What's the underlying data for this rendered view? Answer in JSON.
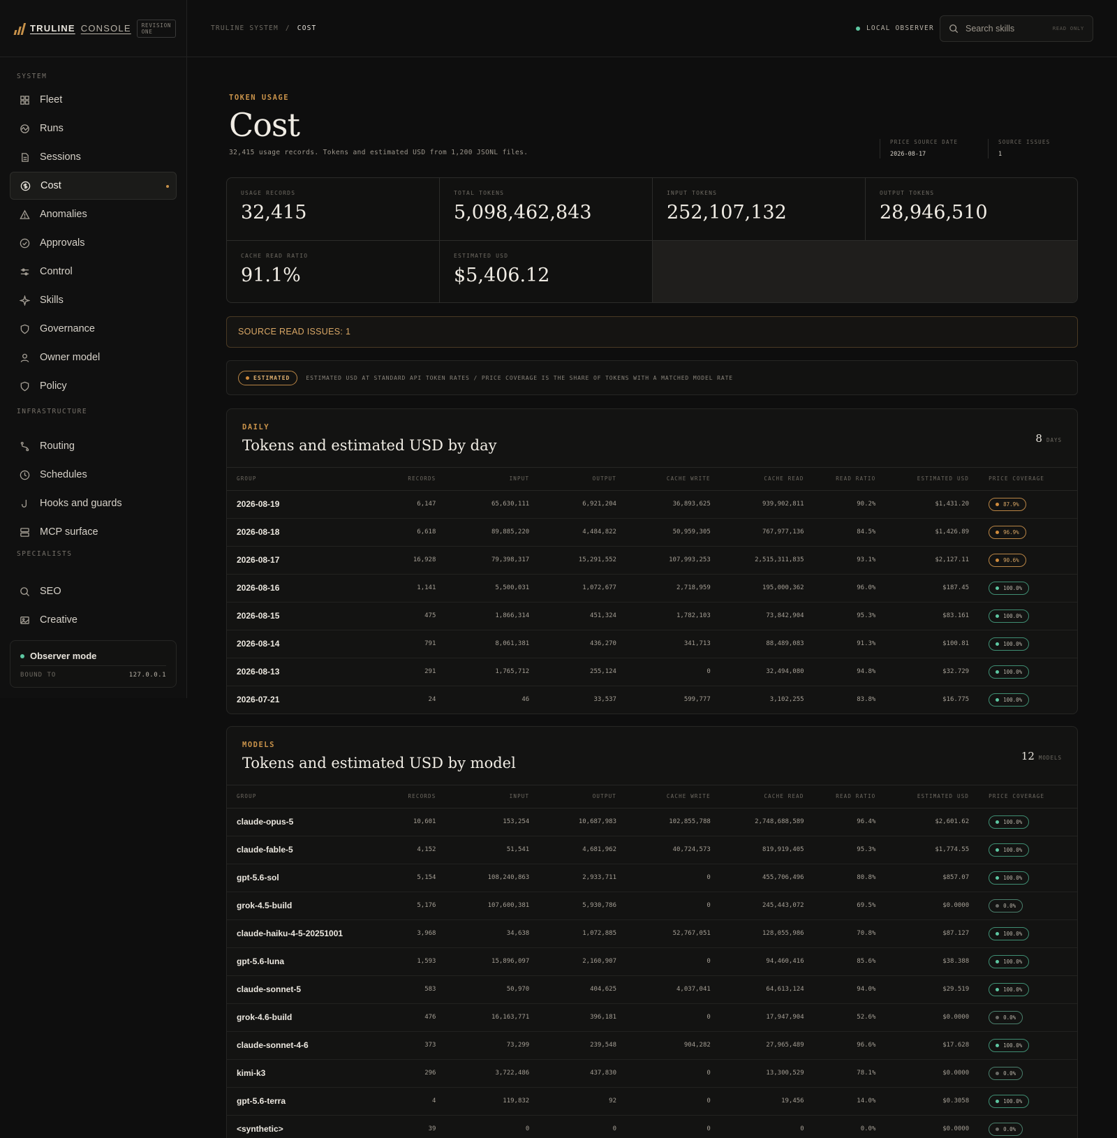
{
  "brand": {
    "name": "TRULINE",
    "console": "CONSOLE",
    "revision": "REVISION ONE"
  },
  "sidebar": {
    "sections": [
      {
        "label": "SYSTEM",
        "items": [
          "Fleet",
          "Runs",
          "Sessions",
          "Cost",
          "Anomalies",
          "Approvals",
          "Control",
          "Skills",
          "Governance",
          "Owner model",
          "Policy"
        ]
      },
      {
        "label": "INFRASTRUCTURE",
        "items": [
          "Routing",
          "Schedules",
          "Hooks and guards",
          "MCP surface"
        ]
      },
      {
        "label": "SPECIALISTS",
        "items": [
          "SEO",
          "Creative"
        ]
      }
    ],
    "active": "Cost",
    "observer": {
      "title": "Observer mode",
      "bound_label": "BOUND TO",
      "bound_value": "127.0.0.1"
    }
  },
  "topbar": {
    "breadcrumb": [
      "TRULINE SYSTEM",
      "/",
      "COST"
    ],
    "status": "LOCAL OBSERVER",
    "search": {
      "placeholder": "Search skills",
      "badge": "READ ONLY"
    }
  },
  "header": {
    "eyebrow": "TOKEN USAGE",
    "title": "Cost",
    "subtitle": "32,415 usage records. Tokens and estimated USD from 1,200 JSONL files.",
    "meta": [
      {
        "label": "PRICE SOURCE DATE",
        "value": "2026-08-17"
      },
      {
        "label": "SOURCE ISSUES",
        "value": "1"
      }
    ]
  },
  "stats": [
    {
      "label": "USAGE RECORDS",
      "value": "32,415"
    },
    {
      "label": "TOTAL TOKENS",
      "value": "5,098,462,843"
    },
    {
      "label": "INPUT TOKENS",
      "value": "252,107,132"
    },
    {
      "label": "OUTPUT TOKENS",
      "value": "28,946,510"
    },
    {
      "label": "CACHE READ RATIO",
      "value": "91.1%"
    },
    {
      "label": "ESTIMATED USD",
      "value": "$5,406.12"
    }
  ],
  "issue_banner": "SOURCE READ ISSUES: 1",
  "estimated_note": {
    "badge": "ESTIMATED",
    "text": "ESTIMATED USD AT STANDARD API TOKEN RATES / PRICE COVERAGE IS THE SHARE OF TOKENS WITH A MATCHED MODEL RATE"
  },
  "columns": [
    "GROUP",
    "RECORDS",
    "INPUT",
    "OUTPUT",
    "CACHE WRITE",
    "CACHE READ",
    "READ RATIO",
    "ESTIMATED USD",
    "PRICE COVERAGE"
  ],
  "daily": {
    "eyebrow": "DAILY",
    "title": "Tokens and estimated USD by day",
    "count": "8",
    "count_unit": "DAYS",
    "rows": [
      [
        "2026-08-19",
        "6,147",
        "65,630,111",
        "6,921,204",
        "36,893,625",
        "939,902,811",
        "90.2%",
        "$1,431.20",
        "87.9%"
      ],
      [
        "2026-08-18",
        "6,618",
        "89,885,220",
        "4,484,822",
        "50,959,305",
        "767,977,136",
        "84.5%",
        "$1,426.89",
        "96.9%"
      ],
      [
        "2026-08-17",
        "16,928",
        "79,398,317",
        "15,291,552",
        "107,993,253",
        "2,515,311,835",
        "93.1%",
        "$2,127.11",
        "90.6%"
      ],
      [
        "2026-08-16",
        "1,141",
        "5,500,031",
        "1,072,677",
        "2,718,959",
        "195,000,362",
        "96.0%",
        "$187.45",
        "100.0%"
      ],
      [
        "2026-08-15",
        "475",
        "1,866,314",
        "451,324",
        "1,782,103",
        "73,842,904",
        "95.3%",
        "$83.161",
        "100.0%"
      ],
      [
        "2026-08-14",
        "791",
        "8,061,381",
        "436,270",
        "341,713",
        "88,489,083",
        "91.3%",
        "$100.81",
        "100.0%"
      ],
      [
        "2026-08-13",
        "291",
        "1,765,712",
        "255,124",
        "0",
        "32,494,080",
        "94.8%",
        "$32.729",
        "100.0%"
      ],
      [
        "2026-07-21",
        "24",
        "46",
        "33,537",
        "599,777",
        "3,102,255",
        "83.8%",
        "$16.775",
        "100.0%"
      ]
    ]
  },
  "models": {
    "eyebrow": "MODELS",
    "title": "Tokens and estimated USD by model",
    "count": "12",
    "count_unit": "MODELS",
    "rows": [
      [
        "claude-opus-5",
        "10,601",
        "153,254",
        "10,687,983",
        "102,855,788",
        "2,748,688,589",
        "96.4%",
        "$2,601.62",
        "100.0%"
      ],
      [
        "claude-fable-5",
        "4,152",
        "51,541",
        "4,681,962",
        "40,724,573",
        "819,919,405",
        "95.3%",
        "$1,774.55",
        "100.0%"
      ],
      [
        "gpt-5.6-sol",
        "5,154",
        "108,240,863",
        "2,933,711",
        "0",
        "455,706,496",
        "80.8%",
        "$857.07",
        "100.0%"
      ],
      [
        "grok-4.5-build",
        "5,176",
        "107,600,381",
        "5,930,786",
        "0",
        "245,443,072",
        "69.5%",
        "$0.0000",
        "0.0%"
      ],
      [
        "claude-haiku-4-5-20251001",
        "3,968",
        "34,638",
        "1,072,885",
        "52,767,051",
        "128,055,986",
        "70.8%",
        "$87.127",
        "100.0%"
      ],
      [
        "gpt-5.6-luna",
        "1,593",
        "15,896,097",
        "2,160,907",
        "0",
        "94,460,416",
        "85.6%",
        "$38.388",
        "100.0%"
      ],
      [
        "claude-sonnet-5",
        "583",
        "50,970",
        "404,625",
        "4,037,041",
        "64,613,124",
        "94.0%",
        "$29.519",
        "100.0%"
      ],
      [
        "grok-4.6-build",
        "476",
        "16,163,771",
        "396,181",
        "0",
        "17,947,904",
        "52.6%",
        "$0.0000",
        "0.0%"
      ],
      [
        "claude-sonnet-4-6",
        "373",
        "73,299",
        "239,548",
        "904,282",
        "27,965,489",
        "96.6%",
        "$17.628",
        "100.0%"
      ],
      [
        "kimi-k3",
        "296",
        "3,722,486",
        "437,830",
        "0",
        "13,300,529",
        "78.1%",
        "$0.0000",
        "0.0%"
      ],
      [
        "gpt-5.6-terra",
        "4",
        "119,832",
        "92",
        "0",
        "19,456",
        "14.0%",
        "$0.3058",
        "100.0%"
      ],
      [
        "<synthetic>",
        "39",
        "0",
        "0",
        "0",
        "0",
        "0.0%",
        "$0.0000",
        "0.0%"
      ]
    ]
  },
  "colors": {
    "accent": "#c8924a",
    "ok": "#5ec7a2",
    "bg": "#0e0e0e"
  }
}
